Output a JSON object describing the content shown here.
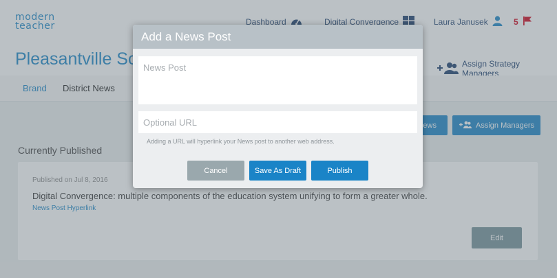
{
  "brand": {
    "logo_line1": "modern",
    "logo_line2": "teacher"
  },
  "topnav": {
    "dashboard": "Dashboard",
    "digital_convergence": "Digital Convergence",
    "user_name": "Laura Janusek",
    "flag_count": "5"
  },
  "district": {
    "name": "Pleasantville School District",
    "assign_strategy_managers": "Assign Strategy Managers"
  },
  "tabs": [
    {
      "label": "Brand"
    },
    {
      "label": "District News"
    }
  ],
  "actions": {
    "news_button": "News",
    "assign_managers": "Assign Managers"
  },
  "published": {
    "section_title": "Currently Published",
    "meta": "Published on Jul 8, 2016",
    "text": "Digital Convergence: multiple components of the education system unifying to form a greater whole.",
    "link": "News Post Hyperlink",
    "edit": "Edit"
  },
  "modal": {
    "title": "Add a News Post",
    "news_post_placeholder": "News Post",
    "news_post_value": "",
    "url_placeholder": "Optional URL",
    "url_value": "",
    "hint": "Adding a URL will hyperlink your News post to another web address.",
    "cancel": "Cancel",
    "save_draft": "Save As Draft",
    "publish": "Publish"
  },
  "colors": {
    "accent": "#1a84c7",
    "logo": "#1b86c6",
    "flag": "#d0021b",
    "edit_button": "#76929a",
    "cancel_button": "#9aa8ad",
    "modal_header": "#b8c1c7"
  },
  "icons": {
    "dashboard": "speedometer-icon",
    "digital_convergence": "grid-icon",
    "user": "user-icon",
    "flag": "flag-icon",
    "assign": "add-users-icon"
  }
}
